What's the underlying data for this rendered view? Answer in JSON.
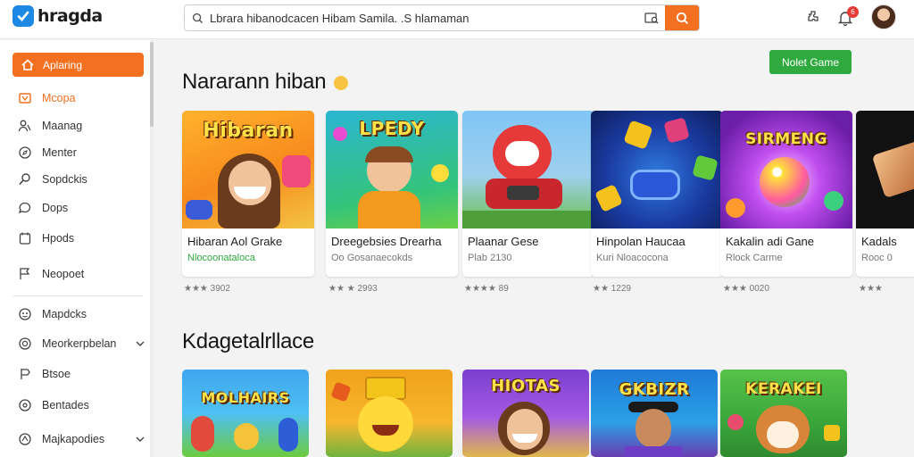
{
  "app": {
    "logo_text": "hragda",
    "brand_color": "#f37021",
    "accent_green": "#2eaa3f",
    "logo_color": "#1e88e5"
  },
  "search": {
    "value": "Lbrara hibanodcacen Hibam Samila. .S hlamaman",
    "icon": "search-icon",
    "camera_icon": "image-search-icon",
    "button_icon": "search-icon"
  },
  "header": {
    "settings_icon": "puzzle-icon",
    "notification_icon": "bell-icon",
    "notification_count": "6"
  },
  "sidebar": {
    "active": {
      "label": "Aplaring",
      "icon": "home-icon"
    },
    "items": [
      {
        "label": "Mcopa",
        "icon": "category-icon"
      },
      {
        "label": "Maanag",
        "icon": "person-icon"
      },
      {
        "label": "Menter",
        "icon": "compass-icon"
      },
      {
        "label": "Sopdckis",
        "icon": "search-icon"
      },
      {
        "label": "Dops",
        "icon": "chat-icon"
      },
      {
        "label": "Hpods",
        "icon": "calendar-icon"
      },
      {
        "label": "Neopoet",
        "icon": "flag-icon"
      },
      {
        "label": "Mapdcks",
        "icon": "group-icon"
      },
      {
        "label": "Meorkerpbelan",
        "icon": "target-icon"
      },
      {
        "label": "Btsoe",
        "icon": "share-icon"
      },
      {
        "label": "Bentades",
        "icon": "globe-icon"
      },
      {
        "label": "Majkapodies",
        "icon": "bookmark-icon"
      }
    ]
  },
  "section1": {
    "title": "Nararann hiban",
    "more_label": "Nolet Game",
    "cards": [
      {
        "thumb_text": "Hibaran",
        "title": "Hibaran Aol Grake",
        "sub": "Nlocoonataloca",
        "rating": "★★★ 3902"
      },
      {
        "thumb_text": "LPEDY",
        "title": "Dreegebsies Drearha",
        "sub": "Oo Gosanaecokds",
        "rating": "★★ ★ 2993"
      },
      {
        "thumb_text": "",
        "title": "Plaanar Gese",
        "sub": "Plab 2130",
        "rating": "★★★★ 89"
      },
      {
        "thumb_text": "",
        "title": "Hinpolan Haucaa",
        "sub": "Kuri Nloacocona",
        "rating": "★★ 1229"
      },
      {
        "thumb_text": "SIRMENG",
        "title": "Kakalin adi Gane",
        "sub": "Rlock Carme",
        "rating": "★★★ 0020"
      },
      {
        "thumb_text": "",
        "title": "Kadals",
        "sub": "Rooc 0",
        "rating": "★★★"
      }
    ]
  },
  "section2": {
    "title": "Kdagetalrllace",
    "cards": [
      {
        "thumb_text": "MOLHAIRS"
      },
      {
        "thumb_text": ""
      },
      {
        "thumb_text": "HIOTAS"
      },
      {
        "thumb_text": "GKBIZR"
      },
      {
        "thumb_text": "KERAKEI"
      }
    ]
  }
}
